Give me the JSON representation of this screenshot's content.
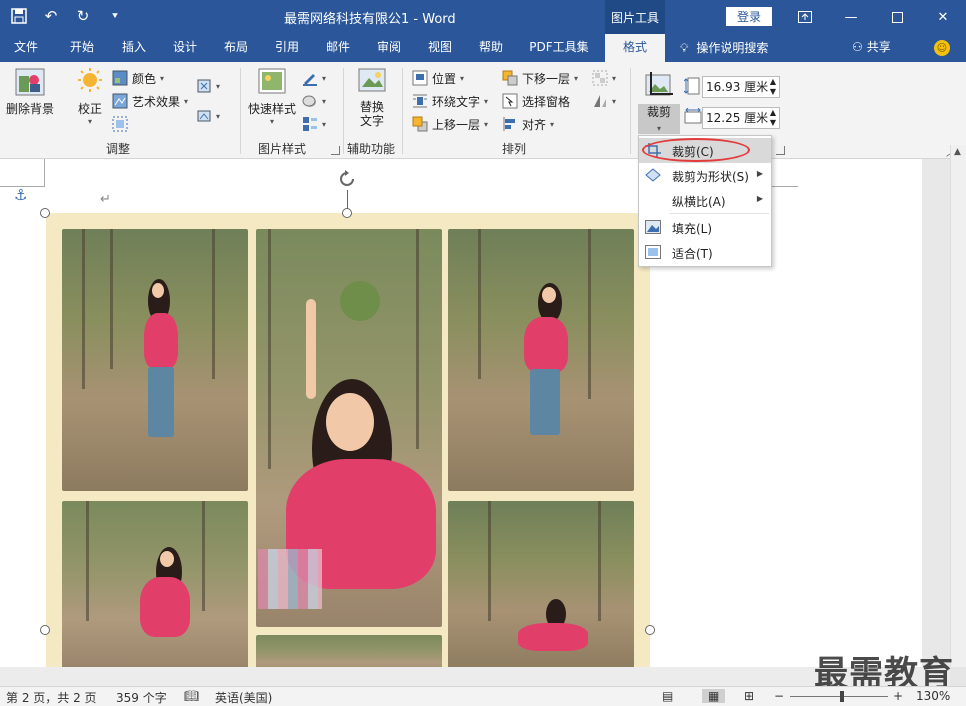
{
  "window": {
    "title": "最需网络科技有限公1 - Word",
    "context_tab_group": "图片工具",
    "login_label": "登录"
  },
  "tabs": [
    {
      "label": "文件"
    },
    {
      "label": "开始"
    },
    {
      "label": "插入"
    },
    {
      "label": "设计"
    },
    {
      "label": "布局"
    },
    {
      "label": "引用"
    },
    {
      "label": "邮件"
    },
    {
      "label": "审阅"
    },
    {
      "label": "视图"
    },
    {
      "label": "帮助"
    },
    {
      "label": "PDF工具集"
    },
    {
      "label": "格式"
    }
  ],
  "tell_me": "操作说明搜索",
  "share": "共享",
  "ribbon": {
    "adjust": {
      "remove_bg": "删除背景",
      "correct": "校正",
      "color": "颜色",
      "artistic": "艺术效果",
      "label": "调整"
    },
    "picture_styles": {
      "quick_styles": "快速样式",
      "label": "图片样式"
    },
    "accessibility": {
      "alt_text": "替换文字",
      "label": "辅助功能"
    },
    "arrange": {
      "position": "位置",
      "wrap_text": "环绕文字",
      "bring_forward": "上移一层",
      "send_backward": "下移一层",
      "selection_pane": "选择窗格",
      "align": "对齐",
      "label": "排列"
    },
    "size": {
      "crop": "裁剪",
      "height": "16.93 厘米",
      "width": "12.25 厘米"
    }
  },
  "crop_menu": {
    "items": [
      {
        "label": "裁剪(C)",
        "icon": "crop-icon"
      },
      {
        "label": "裁剪为形状(S)",
        "icon": "shape-crop-icon",
        "submenu": true
      },
      {
        "label": "纵横比(A)",
        "icon": "",
        "submenu": true
      },
      {
        "label": "填充(L)",
        "icon": "fill-icon"
      },
      {
        "label": "适合(T)",
        "icon": "fit-icon"
      }
    ]
  },
  "status": {
    "page": "第 2 页，共 2 页",
    "words": "359 个字",
    "language": "英语(美国)",
    "zoom": "130%",
    "zoom_minus": "−",
    "zoom_plus": "+"
  },
  "watermark": "最需教育",
  "colors": {
    "brand": "#2b579a",
    "highlight_ring": "#e23b3b"
  }
}
